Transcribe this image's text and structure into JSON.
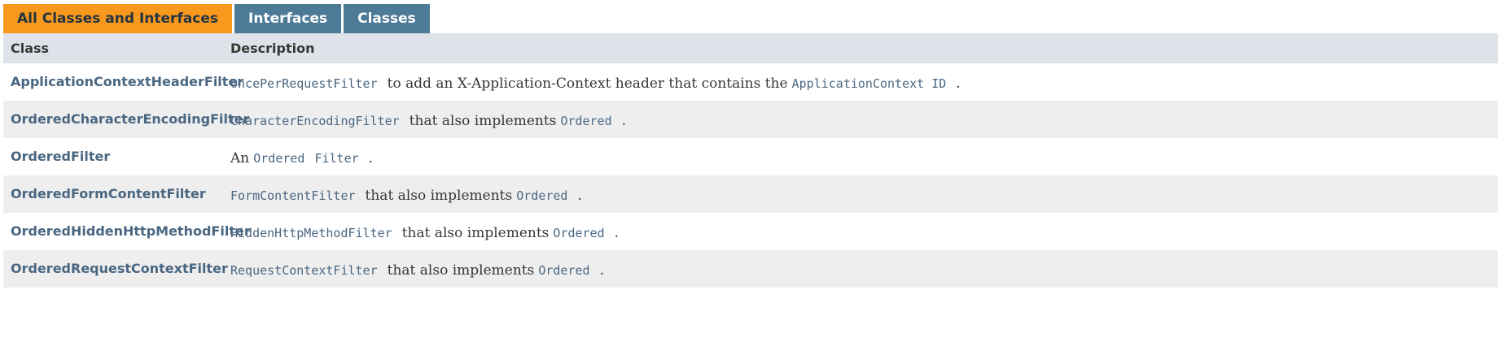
{
  "tabs": [
    {
      "label": "All Classes and Interfaces",
      "active": true
    },
    {
      "label": "Interfaces",
      "active": false
    },
    {
      "label": "Classes",
      "active": false
    }
  ],
  "table": {
    "headers": {
      "class": "Class",
      "description": "Description"
    },
    "rows": [
      {
        "class": "ApplicationContextHeaderFilter",
        "desc": {
          "code1": "OncePerRequestFilter",
          "text1": "to add an X-Application-Context header that contains the",
          "code2": "ApplicationContext ID",
          "end": "."
        }
      },
      {
        "class": "OrderedCharacterEncodingFilter",
        "desc": {
          "code1": "CharacterEncodingFilter",
          "text1": "that also implements",
          "code2": "Ordered",
          "end": "."
        }
      },
      {
        "class": "OrderedFilter",
        "desc": {
          "prefix": "An",
          "code1": "Ordered",
          "code2": "Filter",
          "end": "."
        }
      },
      {
        "class": "OrderedFormContentFilter",
        "desc": {
          "code1": "FormContentFilter",
          "text1": "that also implements",
          "code2": "Ordered",
          "end": "."
        }
      },
      {
        "class": "OrderedHiddenHttpMethodFilter",
        "desc": {
          "code1": "HiddenHttpMethodFilter",
          "text1": "that also implements",
          "code2": "Ordered",
          "end": "."
        }
      },
      {
        "class": "OrderedRequestContextFilter",
        "desc": {
          "code1": "RequestContextFilter",
          "text1": "that also implements",
          "code2": "Ordered",
          "end": "."
        }
      }
    ]
  },
  "colors": {
    "active_tab": "#f8981d",
    "inactive_tab": "#4d7a97",
    "header_bg": "#dee3e9",
    "link": "#4a6782",
    "alt_row": "#eeeeee"
  }
}
